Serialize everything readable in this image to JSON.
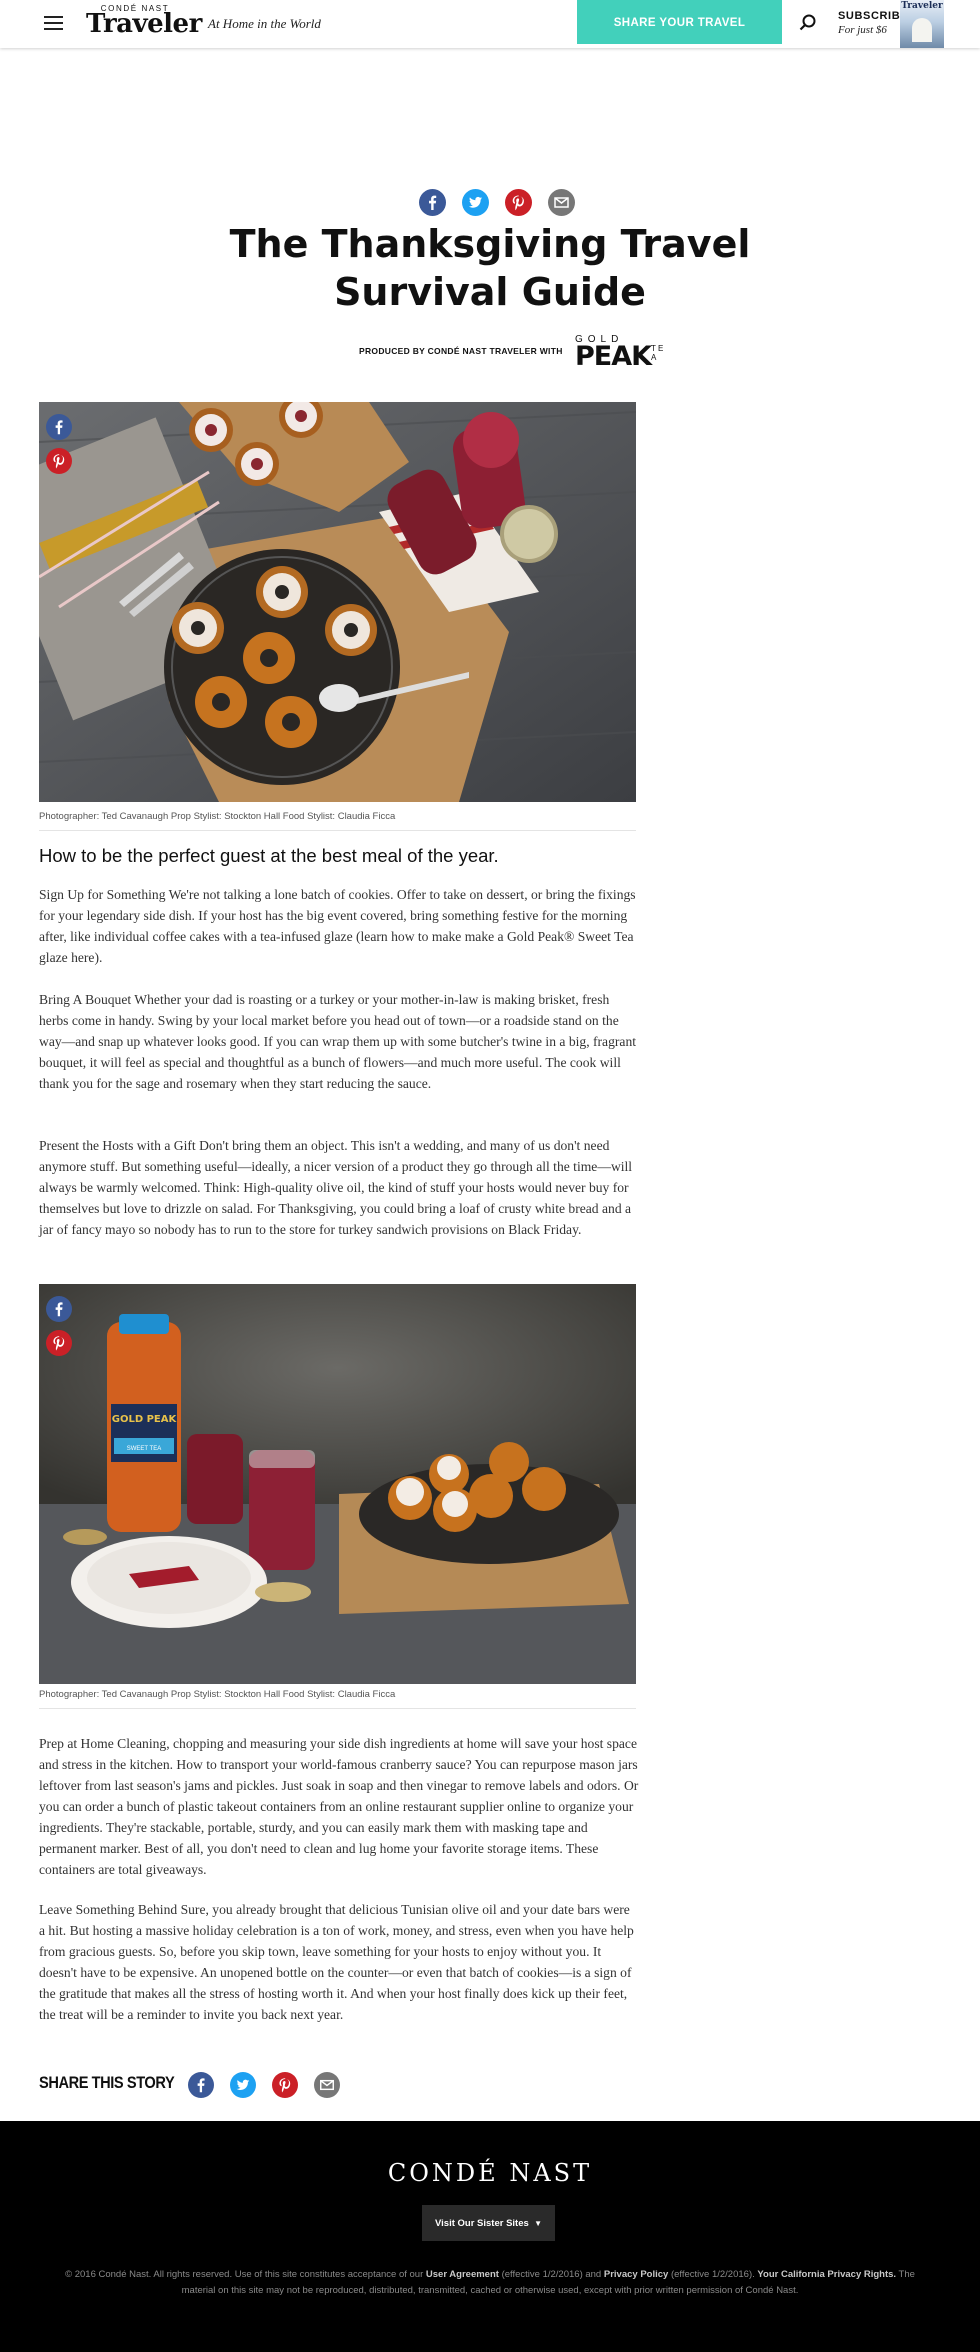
{
  "header": {
    "brand_top": "CONDÉ NAST",
    "brand_name": "Traveler",
    "tagline": "At Home in the World",
    "share_button": "SHARE YOUR TRAVEL EXPERIENCES",
    "subscribe_label": "SUBSCRIBE",
    "subscribe_price": "For just $6",
    "magazine_title": "Traveler"
  },
  "article": {
    "title": "The Thanksgiving Travel Survival Guide",
    "produced_by": "PRODUCED BY CONDÉ NAST TRAVELER WITH",
    "sponsor_logo": {
      "line1": "GOLD",
      "line2": "PEAK",
      "side": "T E A"
    },
    "photo1_credit": "Photographer: Ted Cavanaugh Prop Stylist: Stockton Hall  Food Stylist: Claudia Ficca",
    "subheading": "How to be the perfect guest at the best meal of the year.",
    "paragraphs_part1": [
      "Sign Up for Something We're not talking a lone batch of cookies. Offer to take on dessert, or bring the fixings for your legendary side dish. If your host has the big event covered, bring something festive for the morning after, like individual coffee cakes with a tea-infused glaze (learn how to make make a Gold Peak® Sweet Tea glaze here).",
      "Bring A Bouquet Whether your dad is roasting or a turkey or your mother-in-law is making brisket, fresh herbs come in handy. Swing by your local market before you head out of town—or a roadside stand on the way—and snap up whatever looks good. If you can wrap them up with some butcher's twine in a big, fragrant bouquet, it will feel as special and thoughtful as a bunch of flowers—and much more useful. The cook will thank you for the sage and rosemary when they start reducing the sauce.",
      "Present the Hosts with a Gift Don't bring them an object. This isn't a wedding, and many of us don't need anymore stuff. But something useful—ideally, a nicer version of a product they go through all the time—will always be warmly welcomed. Think: High-quality olive oil, the kind of stuff your hosts would never buy for themselves but love to drizzle on salad. For Thanksgiving, you could bring a loaf of crusty white bread and a jar of fancy mayo so nobody has to run to the store for turkey sandwich provisions on Black Friday."
    ],
    "photo2_credit": "Photographer: Ted Cavanaugh Prop Stylist: Stockton Hall  Food Stylist: Claudia Ficca",
    "photo2_label": {
      "brand": "GOLD PEAK",
      "product": "SWEET TEA"
    },
    "paragraphs_part2": [
      "Prep at Home Cleaning, chopping and measuring your side dish ingredients at home will save your host space and stress in the kitchen. How to transport your world-famous cranberry sauce? You can repurpose mason jars leftover from last season's jams and pickles. Just soak in soap and then vinegar to remove labels and odors. Or you can order a bunch of plastic takeout containers from an online restaurant supplier online to organize your ingredients. They're stackable, portable, sturdy, and you can easily mark them with masking tape and permanent marker. Best of all, you don't need to clean and lug home your favorite storage items. These containers are total giveaways.",
      "Leave Something Behind Sure, you already brought that delicious Tunisian olive oil and your date bars were a hit. But hosting a massive holiday celebration is a ton of work, money, and stress, even when you have help from gracious guests. So, before you skip town, leave something for your hosts to enjoy without you. It doesn't have to be expensive. An unopened bottle on the counter—or even that batch of cookies—is a sign of the gratitude that makes all the stress of hosting worth it. And when your host finally does kick up their feet, the treat will be a reminder to invite you back next year."
    ],
    "share_this_story": "SHARE THIS STORY"
  },
  "footer": {
    "logo": "CONDÉ NAST",
    "sister_sites": "Visit Our Sister Sites",
    "sister_caret": "▼",
    "legal": {
      "t1": "© 2016 Condé Nast. All rights reserved. Use of this site constitutes acceptance of our ",
      "l1": "User Agreement",
      "t2": " (effective 1/2/2016) and ",
      "l2": "Privacy Policy",
      "t3": " (effective 1/2/2016). ",
      "l3": "Your California Privacy Rights.",
      "t4": " The material on this site may not be reproduced, distributed, transmitted, cached or otherwise used, except with prior written permission of Condé Nast."
    }
  },
  "icons": {
    "menu": "hamburger-icon",
    "search": "search-icon",
    "facebook": "facebook-icon",
    "twitter": "twitter-icon",
    "pinterest": "pinterest-icon",
    "email": "email-icon"
  },
  "colors": {
    "accent": "#42d0bb",
    "facebook": "#3b5998",
    "twitter": "#1da1f2",
    "pinterest": "#cb2027",
    "email": "#777777",
    "footer_bg": "#000000"
  }
}
